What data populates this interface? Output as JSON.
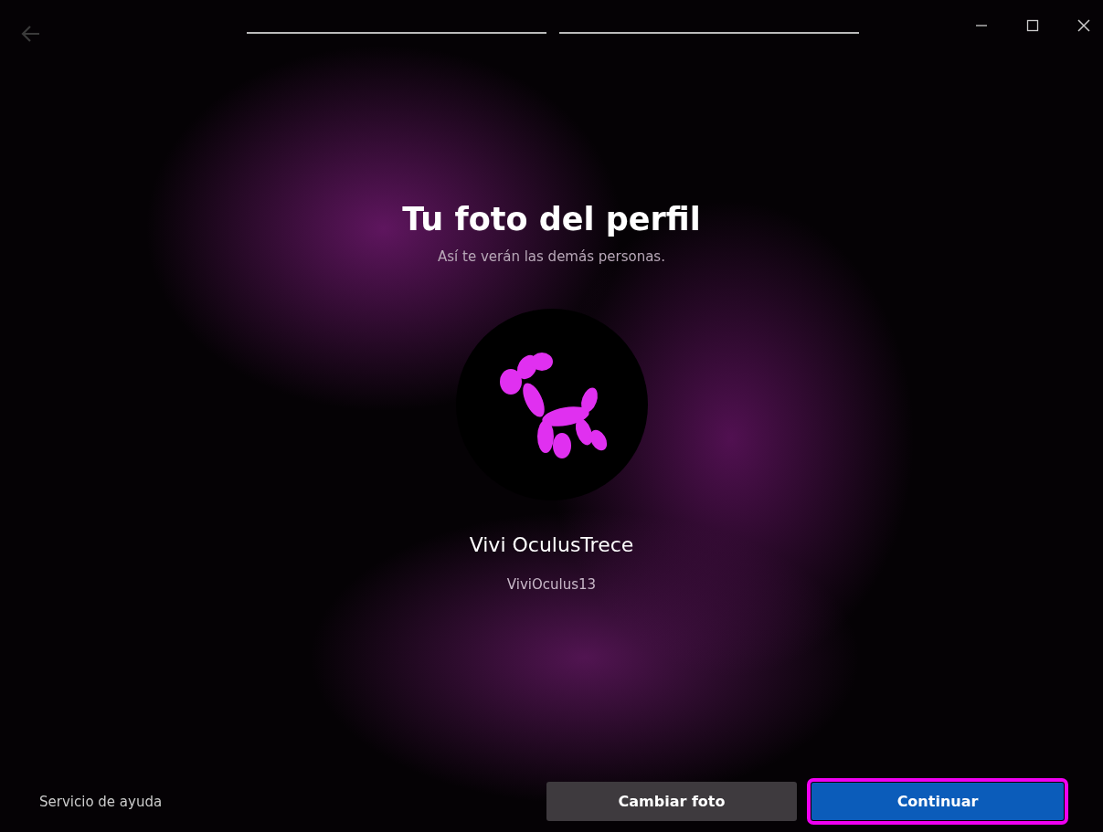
{
  "steps": [
    {
      "done": true
    },
    {
      "done": true
    }
  ],
  "title": "Tu foto del perfil",
  "subtitle": "Así te verán las demás personas.",
  "profile": {
    "display_name": "Vivi OculusTrece",
    "username": "ViviOculus13"
  },
  "help_link": "Servicio de ayuda",
  "buttons": [
    {
      "label": "Cambiar foto",
      "kind": "secondary",
      "focused": false
    },
    {
      "label": "Continuar",
      "kind": "primary",
      "focused": true
    }
  ]
}
